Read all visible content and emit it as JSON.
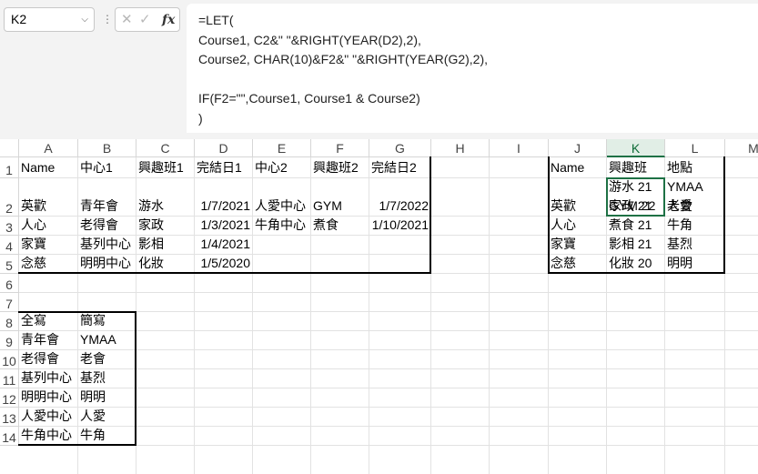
{
  "name_box": {
    "value": "K2"
  },
  "formula_bar": {
    "fx_label": "fx",
    "lines": [
      "=LET(",
      "Course1, C2&\" \"&RIGHT(YEAR(D2),2),",
      "Course2, CHAR(10)&F2&\" \"&RIGHT(YEAR(G2),2),",
      "",
      "IF(F2=\"\",Course1, Course1 & Course2)",
      ")"
    ]
  },
  "columns": [
    "A",
    "B",
    "C",
    "D",
    "E",
    "F",
    "G",
    "H",
    "I",
    "J",
    "K",
    "L",
    "M"
  ],
  "rows": [
    "1",
    "2",
    "3",
    "4",
    "5",
    "6",
    "7",
    "8",
    "9",
    "10",
    "11",
    "12",
    "13",
    "14"
  ],
  "table1": {
    "header": [
      "Name",
      "中心1",
      "興趣班1",
      "完結日1",
      "中心2",
      "興趣班2",
      "完結日2"
    ],
    "rows": [
      [
        "英歡",
        "青年會",
        "游水",
        "1/7/2021",
        "人愛中心",
        "GYM",
        "1/7/2022"
      ],
      [
        "人心",
        "老得會",
        "家政",
        "1/3/2021",
        "牛角中心",
        "煮食",
        "1/10/2021"
      ],
      [
        "家寶",
        "基列中心",
        "影相",
        "1/4/2021",
        "",
        "",
        ""
      ],
      [
        "念慈",
        "明明中心",
        "化妝",
        "1/5/2020",
        "",
        "",
        ""
      ]
    ]
  },
  "table2": {
    "header": [
      "Name",
      "興趣班",
      "地點"
    ],
    "rows": [
      [
        "英歡",
        "游水 21\nGYM 22",
        "YMAA\n人愛"
      ],
      [
        "人心",
        "家政 21\n煮食 21",
        "老會\n牛角"
      ],
      [
        "家寶",
        "影相 21",
        "基烈"
      ],
      [
        "念慈",
        "化妝 20",
        "明明"
      ]
    ]
  },
  "table3": {
    "header": [
      "全寫",
      "簡寫"
    ],
    "rows": [
      [
        "青年會",
        "YMAA"
      ],
      [
        "老得會",
        "老會"
      ],
      [
        "基列中心",
        "基烈"
      ],
      [
        "明明中心",
        "明明"
      ],
      [
        "人愛中心",
        "人愛"
      ],
      [
        "牛角中心",
        "牛角"
      ]
    ]
  },
  "selected_column": "K",
  "colors": {
    "selection": "#1e7145",
    "header_selected_bg": "#e1eee6"
  }
}
